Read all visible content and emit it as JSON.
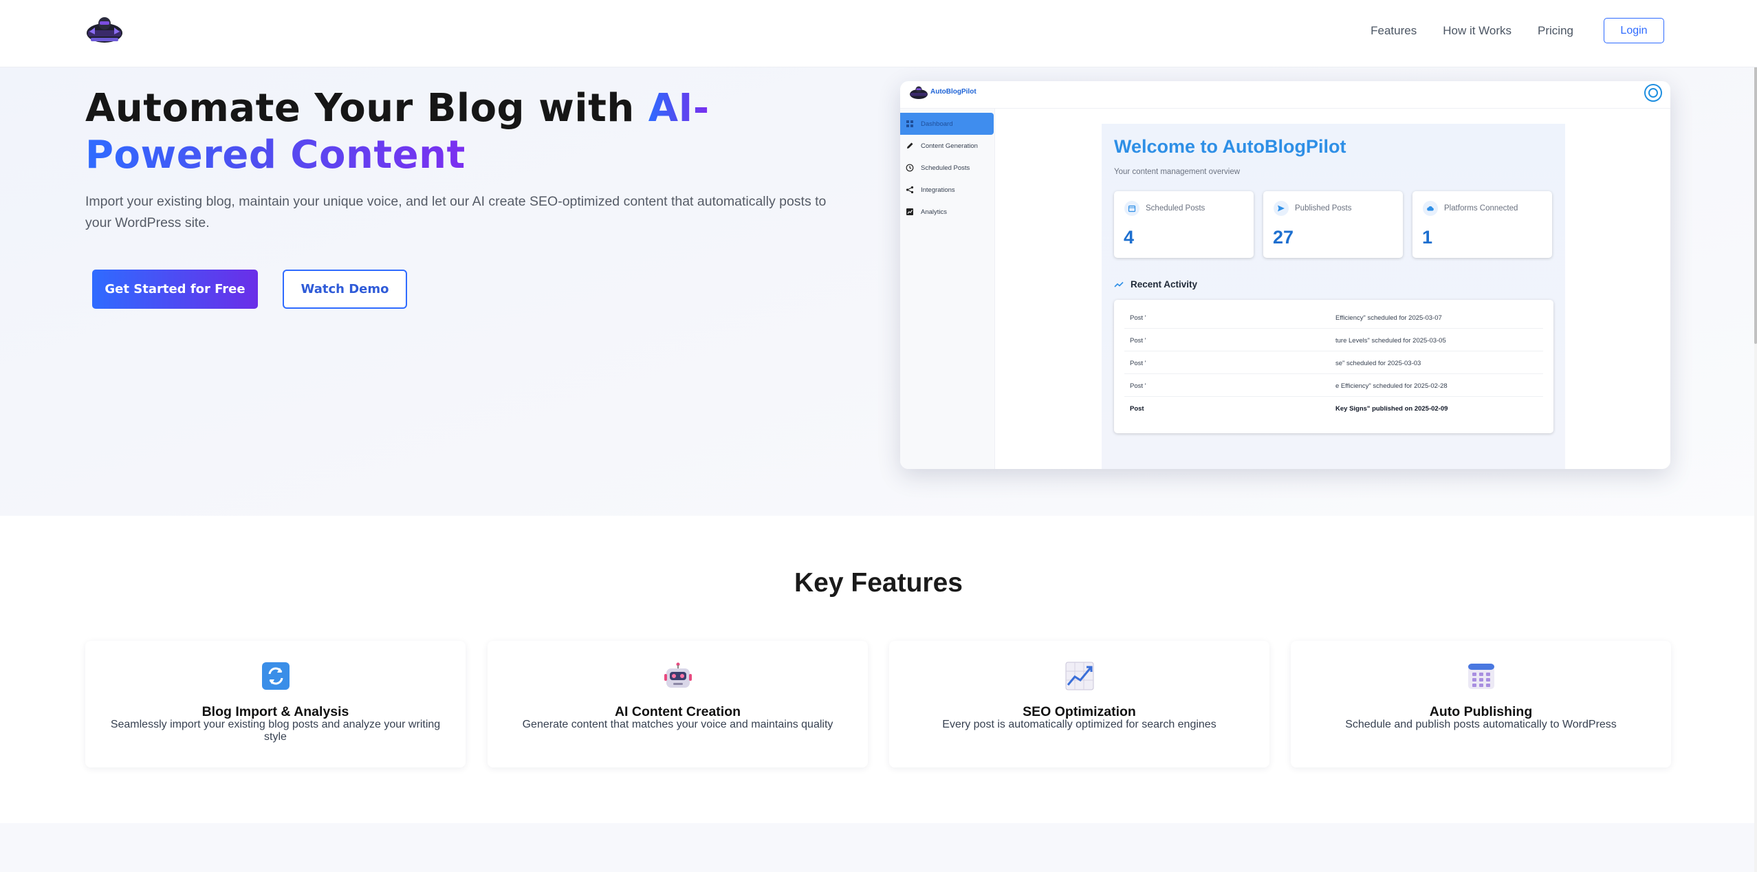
{
  "nav": {
    "logo_alt": "AutoBlogPilot",
    "links": [
      "Features",
      "How it Works",
      "Pricing"
    ],
    "login_label": "Login"
  },
  "hero": {
    "title_part1": "Automate Your Blog with ",
    "title_accent_a": "AI-",
    "title_accent_b": "Powered Content",
    "subtitle": "Import your existing blog, maintain your unique voice, and let our AI create SEO-optimized content that automatically posts to your WordPress site.",
    "primary_cta": "Get Started for Free",
    "secondary_cta": "Watch Demo"
  },
  "preview": {
    "brand": "AutoBlogPilot",
    "sidebar": [
      {
        "label": "Dashboard",
        "icon": "dashboard-icon",
        "active": true
      },
      {
        "label": "Content Generation",
        "icon": "pencil-icon",
        "active": false
      },
      {
        "label": "Scheduled Posts",
        "icon": "clock-icon",
        "active": false
      },
      {
        "label": "Integrations",
        "icon": "share-icon",
        "active": false
      },
      {
        "label": "Analytics",
        "icon": "chart-icon",
        "active": false
      }
    ],
    "welcome": "Welcome to AutoBlogPilot",
    "overview": "Your content management overview",
    "stats": [
      {
        "label": "Scheduled Posts",
        "value": "4",
        "icon": "calendar-icon"
      },
      {
        "label": "Published Posts",
        "value": "27",
        "icon": "send-icon"
      },
      {
        "label": "Platforms Connected",
        "value": "1",
        "icon": "cloud-icon"
      }
    ],
    "recent_activity_title": "Recent Activity",
    "activity": [
      {
        "prefix": "Post '",
        "suffix": "Efficiency\" scheduled for 2025-03-07",
        "bold": false
      },
      {
        "prefix": "Post '",
        "suffix": "ture Levels\" scheduled for 2025-03-05",
        "bold": false
      },
      {
        "prefix": "Post '",
        "suffix": "se\" scheduled for 2025-03-03",
        "bold": false
      },
      {
        "prefix": "Post '",
        "suffix": "e Efficiency\" scheduled for 2025-02-28",
        "bold": false
      },
      {
        "prefix": "Post",
        "suffix": "Key Signs\" published on 2025-02-09",
        "bold": true
      }
    ]
  },
  "features": {
    "title": "Key Features",
    "items": [
      {
        "title": "Blog Import & Analysis",
        "desc": "Seamlessly import your existing blog posts and analyze your writing style",
        "icon": "refresh-icon"
      },
      {
        "title": "AI Content Creation",
        "desc": "Generate content that matches your voice and maintains quality",
        "icon": "robot-icon"
      },
      {
        "title": "SEO Optimization",
        "desc": "Every post is automatically optimized for search engines",
        "icon": "trend-chart-icon"
      },
      {
        "title": "Auto Publishing",
        "desc": "Schedule and publish posts automatically to WordPress",
        "icon": "calendar-icon"
      }
    ]
  },
  "colors": {
    "primary": "#2f6bff",
    "accent_purple": "#6a2ee8",
    "preview_blue": "#2e8fe6"
  }
}
